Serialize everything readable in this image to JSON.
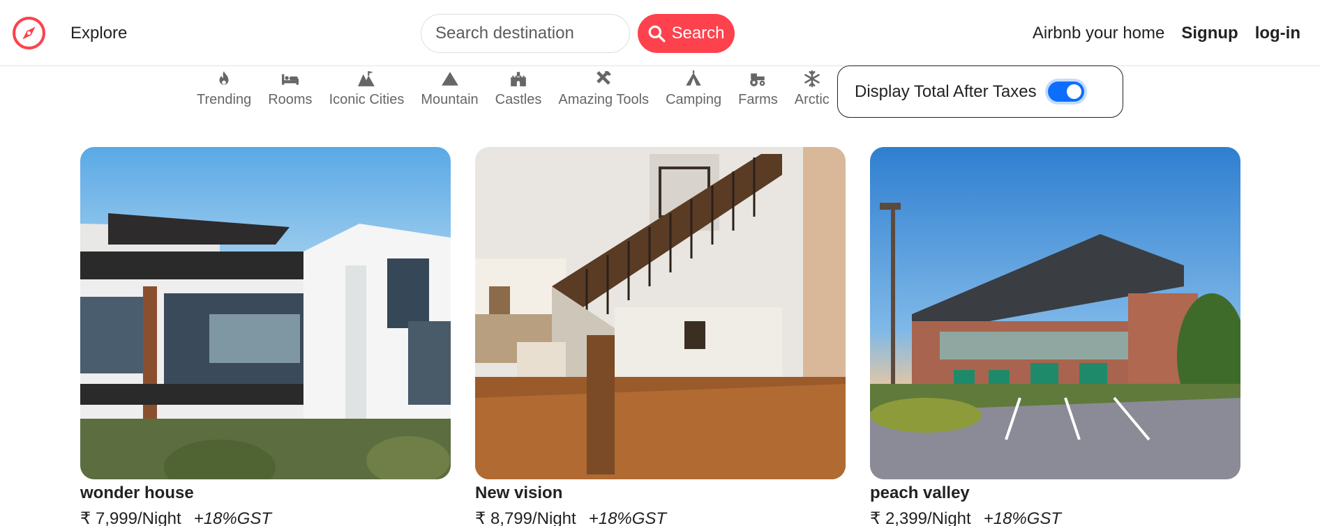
{
  "nav": {
    "explore": "Explore",
    "search_placeholder": "Search destination",
    "search_button": "Search",
    "host": "Airbnb your home",
    "signup": "Signup",
    "login": "log-in"
  },
  "filters": [
    {
      "label": "Trending",
      "icon": "fire-icon"
    },
    {
      "label": "Rooms",
      "icon": "bed-icon"
    },
    {
      "label": "Iconic Cities",
      "icon": "city-icon"
    },
    {
      "label": "Mountain",
      "icon": "mountain-icon"
    },
    {
      "label": "Castles",
      "icon": "castle-icon"
    },
    {
      "label": "Amazing Tools",
      "icon": "tools-icon"
    },
    {
      "label": "Camping",
      "icon": "tent-icon"
    },
    {
      "label": "Farms",
      "icon": "tractor-icon"
    },
    {
      "label": "Arctic",
      "icon": "snowflake-icon"
    }
  ],
  "tax_toggle": {
    "label": "Display Total After Taxes",
    "checked": true
  },
  "listings": [
    {
      "title": "wonder house",
      "price": "₹ 7,999/Night",
      "gst": "+18%GST"
    },
    {
      "title": "New vision",
      "price": "₹ 8,799/Night",
      "gst": "+18%GST"
    },
    {
      "title": "peach valley",
      "price": "₹ 2,399/Night",
      "gst": "+18%GST"
    }
  ],
  "colors": {
    "brand": "#fe424d",
    "toggle": "#0d6efd",
    "text": "#222222",
    "muted": "#666666"
  }
}
